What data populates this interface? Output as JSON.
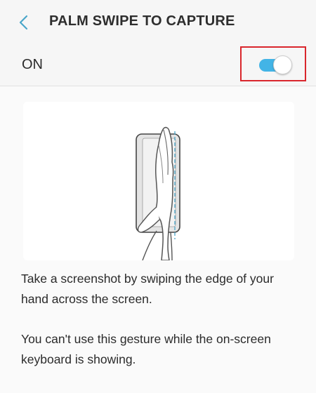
{
  "header": {
    "title": "PALM SWIPE TO CAPTURE",
    "back_icon": "chevron-left-icon"
  },
  "toggle_row": {
    "label": "ON",
    "state": "on",
    "accent_color": "#43b4e6",
    "highlight_color": "#d9262c"
  },
  "illustration": {
    "icon": "palm-swipe-illustration"
  },
  "description": {
    "line1": "Take a screenshot by swiping the edge of your hand across the screen.",
    "line2": "You can't use this gesture while the on-screen keyboard is showing."
  }
}
